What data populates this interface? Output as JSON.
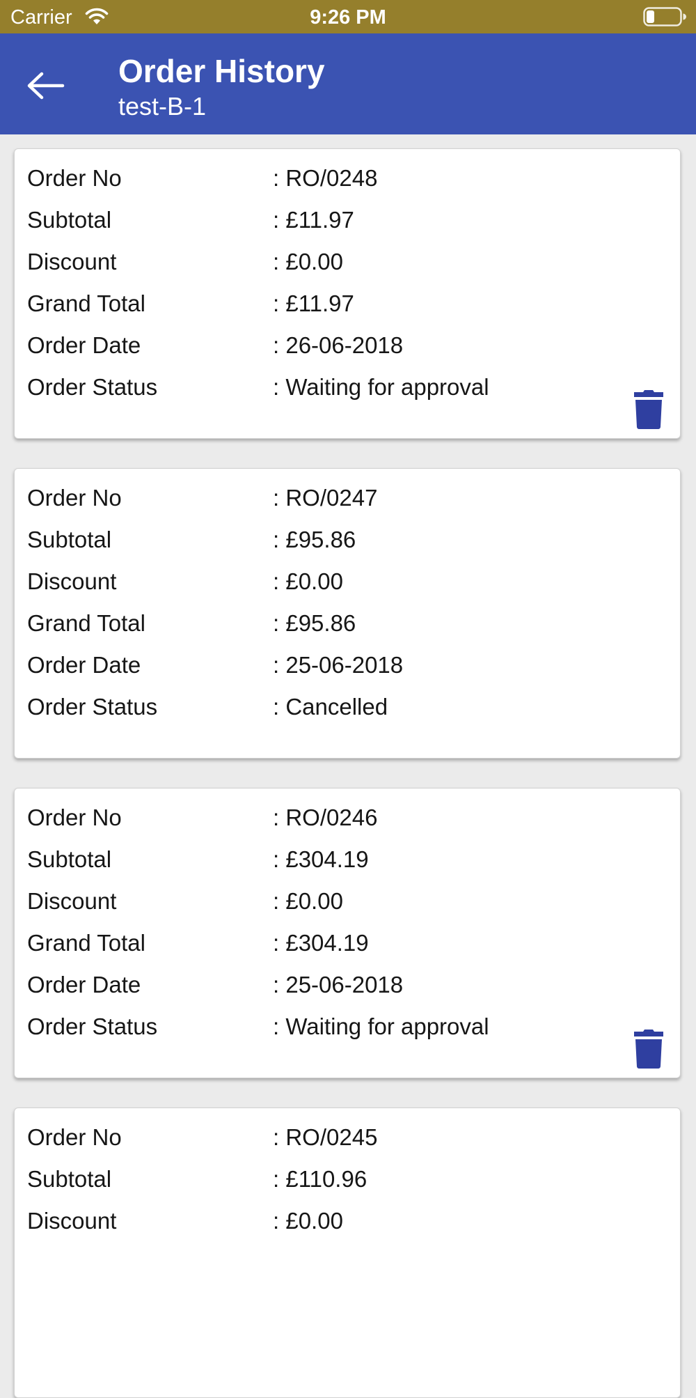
{
  "status_bar": {
    "carrier": "Carrier",
    "time": "9:26 PM",
    "icons": [
      "wifi-icon",
      "battery-icon"
    ]
  },
  "app_bar": {
    "title": "Order History",
    "subtitle": "test-B-1",
    "back_icon": "arrow-left-icon",
    "background_color": "#3b53b2"
  },
  "colors": {
    "status_bar": "#957f2c",
    "page_background": "#ebebeb",
    "delete_icon": "#2f3fa0"
  },
  "field_labels": {
    "order_no": "Order No",
    "subtotal": "Subtotal",
    "discount": "Discount",
    "grand_total": "Grand Total",
    "order_date": "Order Date",
    "order_status": "Order Status"
  },
  "orders": [
    {
      "order_no": ": RO/0248",
      "subtotal": ": £11.97",
      "discount": ": £0.00",
      "grand_total": ": £11.97",
      "order_date": ": 26-06-2018",
      "order_status": ": Waiting for approval",
      "has_delete": true
    },
    {
      "order_no": ": RO/0247",
      "subtotal": ": £95.86",
      "discount": ": £0.00",
      "grand_total": ": £95.86",
      "order_date": ": 25-06-2018",
      "order_status": ": Cancelled",
      "has_delete": false
    },
    {
      "order_no": ": RO/0246",
      "subtotal": ": £304.19",
      "discount": ": £0.00",
      "grand_total": ": £304.19",
      "order_date": ": 25-06-2018",
      "order_status": ": Waiting for approval",
      "has_delete": true
    },
    {
      "order_no": ": RO/0245",
      "subtotal": ": £110.96",
      "discount": ": £0.00",
      "grand_total": "",
      "order_date": "",
      "order_status": "",
      "has_delete": false
    }
  ]
}
